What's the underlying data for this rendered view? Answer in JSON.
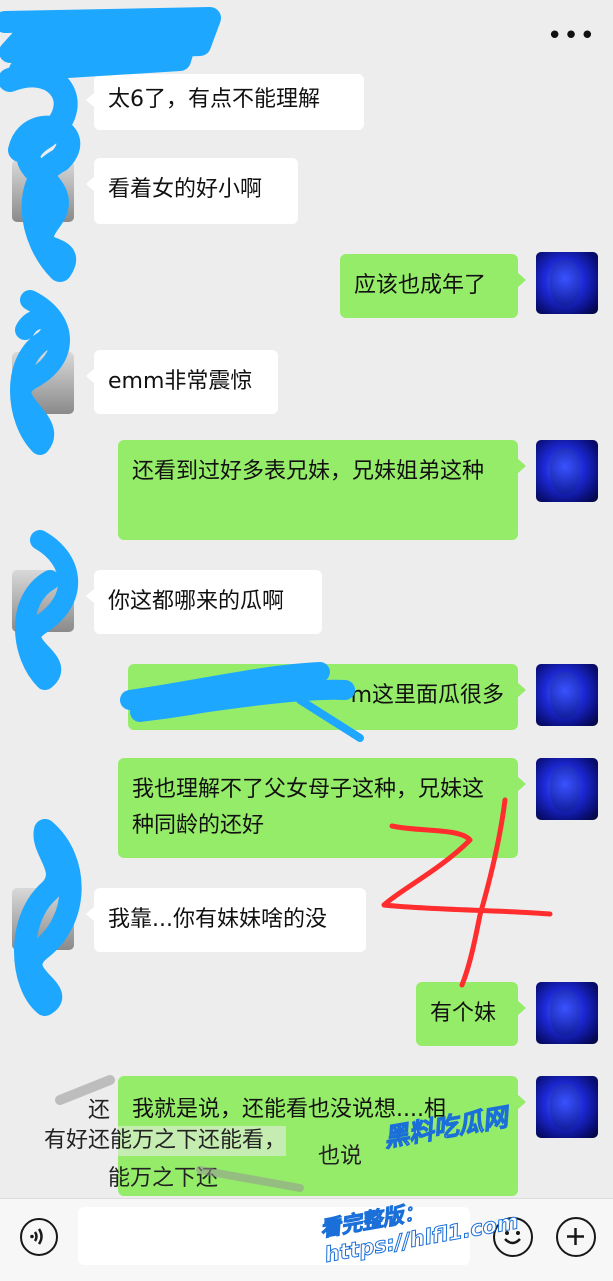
{
  "header": {
    "more_icon": "more-icon",
    "more_glyph": "•••"
  },
  "messages": [
    {
      "side": "in",
      "text": "太6了，有点不能理解"
    },
    {
      "side": "in",
      "text": "看着女的好小啊"
    },
    {
      "side": "out",
      "text": "应该也成年了"
    },
    {
      "side": "in",
      "text": "emm非常震惊"
    },
    {
      "side": "out",
      "text": "还看到过好多表兄妹，兄妹姐弟这种"
    },
    {
      "side": "in",
      "text": "你这都哪来的瓜啊"
    },
    {
      "side": "out",
      "text": "m这里面瓜很多"
    },
    {
      "side": "out",
      "text": "我也理解不了父女母子这种，兄妹这种同龄的还好"
    },
    {
      "side": "in",
      "text": "我靠...你有妹妹啥的没"
    },
    {
      "side": "out",
      "text": "有个妹"
    },
    {
      "side": "out",
      "text": "我就是说，还能看也没说想....相"
    }
  ],
  "overlay_texts": [
    "还",
    "有好还能万之下还能看，",
    "也说",
    "能万之下还"
  ],
  "watermark": {
    "line1": "黑料吃瓜网",
    "line2": "看完整版：https://hlfl1.com"
  },
  "bottom_bar": {
    "voice_icon": "voice-icon",
    "emoji_icon": "emoji-icon",
    "plus_icon": "plus-icon",
    "input_value": ""
  },
  "colors": {
    "background": "#ededed",
    "incoming_bubble": "#ffffff",
    "outgoing_bubble": "#95ec69",
    "redaction": "#1ea7ff",
    "annotation": "#ff2d2d"
  }
}
